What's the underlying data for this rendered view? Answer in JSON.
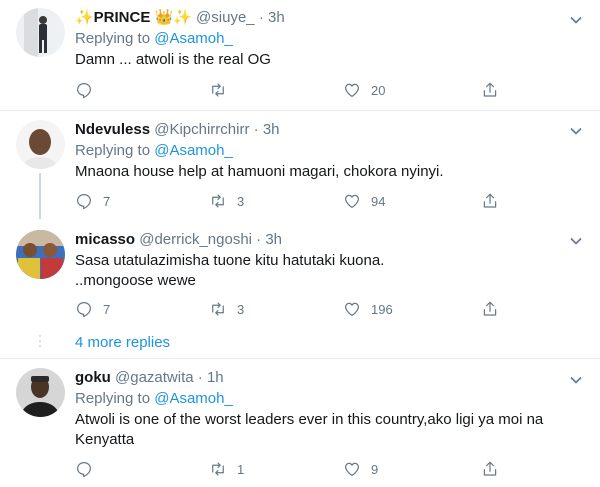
{
  "tweets": [
    {
      "name": "✨PRINCE 👑✨",
      "handle": "@siuye_",
      "dot": "·",
      "time": "3h",
      "replying_prefix": "Replying to",
      "replying_to": "@Asamoh_",
      "lines": [
        "Damn ... atwoli is the real OG"
      ],
      "reply_count": "",
      "retweet_count": "",
      "like_count": "20"
    },
    {
      "name": "Ndevuless",
      "handle": "@Kipchirrchirr",
      "dot": "·",
      "time": "3h",
      "replying_prefix": "Replying to",
      "replying_to": "@Asamoh_",
      "lines": [
        "Mnaona house help at hamuoni magari, chokora nyinyi."
      ],
      "reply_count": "7",
      "retweet_count": "3",
      "like_count": "94"
    },
    {
      "name": "micasso",
      "handle": "@derrick_ngoshi",
      "dot": "·",
      "time": "3h",
      "replying_prefix": "",
      "replying_to": "",
      "lines": [
        "Sasa utatulazimisha tuone kitu hatutaki kuona.",
        "..mongoose wewe"
      ],
      "reply_count": "7",
      "retweet_count": "3",
      "like_count": "196"
    },
    {
      "name": "goku",
      "handle": "@gazatwita",
      "dot": "·",
      "time": "1h",
      "replying_prefix": "Replying to",
      "replying_to": "@Asamoh_",
      "lines": [
        "Atwoli is one of the worst leaders ever in this country,ako ligi ya moi na",
        "Kenyatta"
      ],
      "reply_count": "",
      "retweet_count": "1",
      "like_count": "9"
    }
  ],
  "more_replies": "4 more replies",
  "colors": {
    "accent": "#1b95e0",
    "secondary_text": "#657786",
    "primary_text": "#14171a",
    "divider": "#e6ecf0"
  },
  "icons": [
    "reply-icon",
    "retweet-icon",
    "like-icon",
    "share-icon",
    "chevron-down-icon"
  ]
}
